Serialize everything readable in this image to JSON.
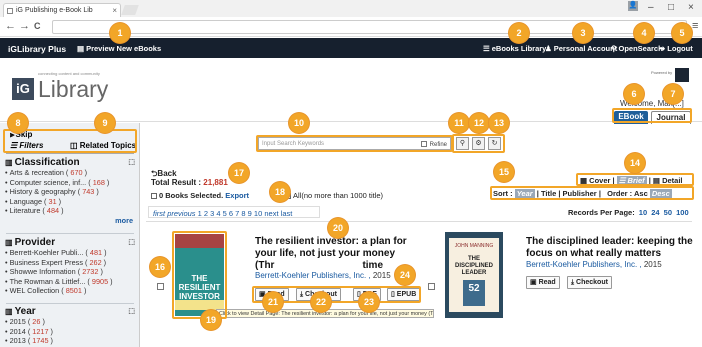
{
  "browser": {
    "tab_title": "iG Publishing e-Book Lib",
    "close_glyph": "×",
    "win_min": "–",
    "win_max": "□",
    "win_close": "×",
    "back": "←",
    "forward": "→",
    "reload": "C",
    "menu": "≡"
  },
  "header": {
    "brand": "iGLibrary Plus",
    "preview": "Preview New eBooks",
    "ebooks_library": "eBooks Library",
    "personal_account": "Personal Account",
    "opensearch": "OpenSearch",
    "logout": "Logout"
  },
  "logo": {
    "mark": "iG",
    "name": "Library",
    "tagline": "connecting content and community",
    "powered_by": "Powered by",
    "welcome": "Welcome, Mak[...]"
  },
  "type_tabs": {
    "ebook": "EBook",
    "journal": "Journal"
  },
  "sidebar": {
    "skip": "Skip",
    "filters": "Filters",
    "related": "Related Topics",
    "more": "more",
    "facets": [
      {
        "title": "Classification",
        "items": [
          {
            "label": "Arts & recreation",
            "count": "670"
          },
          {
            "label": "Computer science, inf...",
            "count": "168"
          },
          {
            "label": "History & geography",
            "count": "743"
          },
          {
            "label": "Language",
            "count": "31"
          },
          {
            "label": "Literature",
            "count": "484"
          }
        ]
      },
      {
        "title": "Provider",
        "items": [
          {
            "label": "Berrett-Koehler Publi...",
            "count": "481"
          },
          {
            "label": "Business Expert Press",
            "count": "262"
          },
          {
            "label": "Showwe Information",
            "count": "2732"
          },
          {
            "label": "The Rowman & Littlef...",
            "count": "9905"
          },
          {
            "label": "WEL Collection",
            "count": "8501"
          }
        ]
      },
      {
        "title": "Year",
        "items": [
          {
            "label": "2015",
            "count": "26"
          },
          {
            "label": "2014",
            "count": "1217"
          },
          {
            "label": "2013",
            "count": "1745"
          }
        ]
      }
    ]
  },
  "search": {
    "placeholder": "Input Search Keywords",
    "refine": "Refine"
  },
  "results": {
    "back": "Back",
    "total_label": "Total Result : ",
    "total_value": "21,881",
    "selected": "0 Books Selected.",
    "export": "Export",
    "select_all": "All(no more than 1000 title)",
    "view_label": "",
    "view_cover": "Cover",
    "view_brief": "Brief",
    "view_detail": "Detail",
    "sort_label": "Sort :",
    "sort_year": "Year",
    "sort_title": "Title",
    "sort_publisher": "Publisher",
    "order_label": "Order : Asc",
    "order_desc": "Desc",
    "pager_first": "first",
    "pager_prev": "previous",
    "pager_pages": "1 2 3 4 5 6 7 8 9 10",
    "pager_next": "next",
    "pager_last": "last",
    "records_label": "Records Per Page:",
    "records_options": [
      "10",
      "24",
      "50",
      "100"
    ]
  },
  "books": [
    {
      "title": "The resilient investor: a plan for your life, not just your money (Thri... in turbulent time)",
      "title_line1": "The resilient investor: a plan for",
      "title_line2": "your life, not just your money",
      "title_line3": "(Thr",
      "title_line3b": "time",
      "publisher": "Berrett-Koehler Publishers, Inc.",
      "year": "2015",
      "cover_title": "THE RESILIENT INVESTOR",
      "actions": {
        "read": "Read",
        "checkout": "Checkout",
        "pdf": "PDF",
        "epub": "EPUB"
      },
      "tooltip": "Click to view Detail Page: The resilient investor: a plan for your life, not just your money (Thrive in turbulent times)"
    },
    {
      "title_line1": "The disciplined leader: keeping the",
      "title_line2": "focus on what really matters",
      "publisher": "Berrett-Koehler Publishers, Inc.",
      "year": "2015",
      "cover_author": "JOHN MANNING",
      "cover_title": "THE DISCIPLINED LEADER",
      "cover_number": "52",
      "actions": {
        "read": "Read",
        "checkout": "Checkout"
      }
    }
  ],
  "markers": [
    "1",
    "2",
    "3",
    "4",
    "5",
    "6",
    "7",
    "8",
    "9",
    "10",
    "11",
    "12",
    "13",
    "14",
    "15",
    "16",
    "17",
    "18",
    "19",
    "20",
    "21",
    "22",
    "23",
    "24"
  ],
  "colors": {
    "header_bg": "#16202e",
    "accent": "#1f5f9a",
    "marker": "#f2a628",
    "count": "#c0392b",
    "link": "#1a5aa0"
  },
  "icons": {
    "search": "search-icon",
    "settings": "gear-icon",
    "reset": "refresh-icon"
  }
}
